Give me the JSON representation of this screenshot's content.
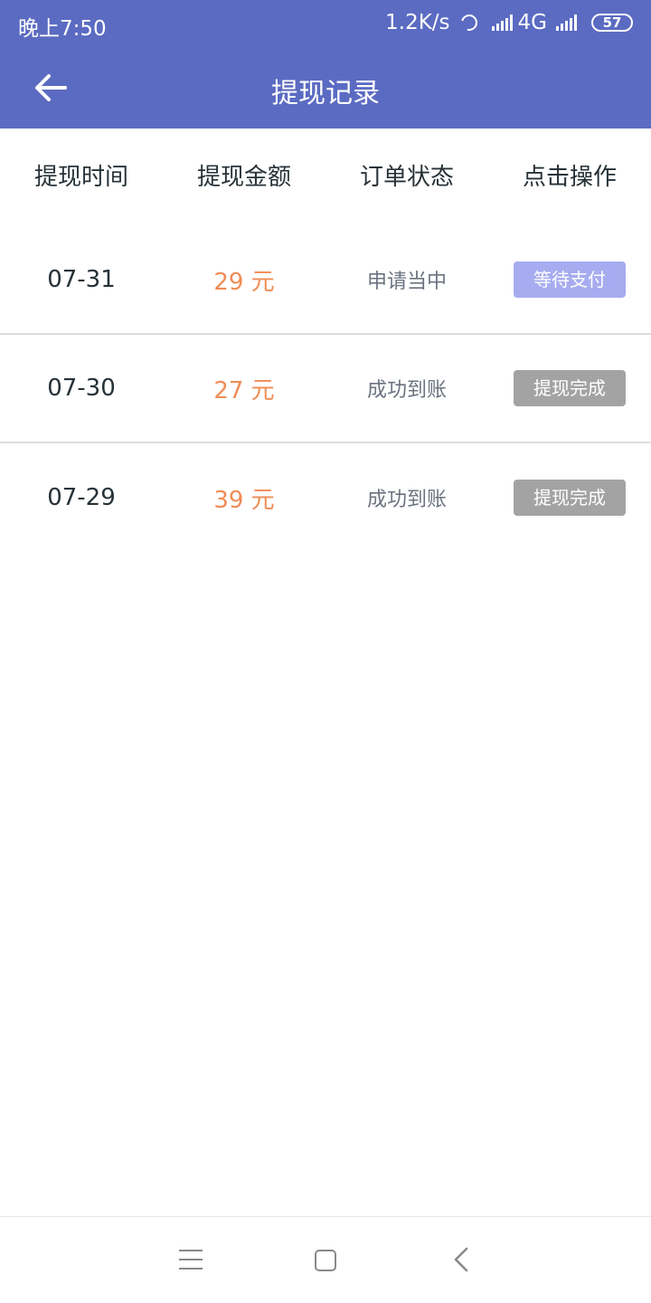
{
  "status_bar": {
    "time": "晚上7:50",
    "speed": "1.2K/s",
    "network": "4G",
    "battery": "57"
  },
  "toolbar": {
    "title": "提现记录",
    "back_icon": "arrow-left-icon"
  },
  "table": {
    "headers": [
      "提现时间",
      "提现金额",
      "订单状态",
      "点击操作"
    ],
    "rows": [
      {
        "date": "07-31",
        "amount": "29 元",
        "status": "申请当中",
        "action": "等待支付",
        "action_state": "pending"
      },
      {
        "date": "07-30",
        "amount": "27 元",
        "status": "成功到账",
        "action": "提现完成",
        "action_state": "done"
      },
      {
        "date": "07-29",
        "amount": "39 元",
        "status": "成功到账",
        "action": "提现完成",
        "action_state": "done"
      }
    ]
  },
  "colors": {
    "header_bg": "#5b6bc2",
    "amount": "#ef8c56",
    "pending_button": "#a6acef",
    "done_button": "#a3a3a3"
  }
}
